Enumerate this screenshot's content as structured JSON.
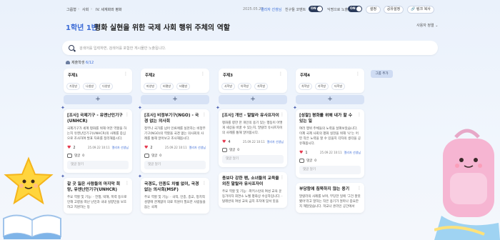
{
  "breadcrumb": [
    "그룹형",
    "사회",
    "IV. 세계화와 평화"
  ],
  "date": "2025.05.22",
  "teacher": "엘리자 선생님",
  "anon_label": "친구들 코멘트",
  "anon_toggle": "ON",
  "like_label": "익명으로 노출",
  "like_toggle": "ON",
  "buttons": {
    "settings": "설정",
    "share": "공유설정",
    "copy_link": "링크 복사"
  },
  "grade": "1학년 1반",
  "title": "평화 실현을 위한 국제 사회 행위 주체의 역할",
  "sort_label": "사용자 정렬",
  "search_placeholder": "검색어를 입력하면, 검색어를 포함한 게시물만 노출됩니다.",
  "students_label": "제출학생",
  "students_count": "6/12",
  "add_group": "그룹 추가",
  "add_symbol": "+",
  "comment_label": "댓글",
  "comment_placeholder": "댓글 달기",
  "columns": [
    {
      "title": "주제1",
      "tags": [
        "가정방",
        "나침방",
        "다양방"
      ],
      "cards": [
        {
          "title": "[조사] 국제기구 - 유엔난민기구(UNHCR)",
          "body": "국제기구가 세계 평화를 위해 어떤 역할을 하는지 유엔난민기구(UNHCR)의 사례를 중심으로 조사하여 발표 자료를 정리해봅시다.",
          "likes": "2",
          "date": "25.09.22 10:11",
          "author": "엘리자 선생님",
          "comments": "0"
        },
        {
          "title": "갈 곳 잃은 사람들의 마지막 희망, 유엔난민기구(UNHCR)",
          "body": "주요 역할 및 기능: · 전쟁, 박해, 폭력 등으로 인해 고향을 떠난 난민과 국내 실향민을 보호하고 지원하는 등"
        }
      ]
    },
    {
      "title": "주제2",
      "tags": [
        "마양방",
        "비평방",
        "비평방"
      ],
      "cards": [
        {
          "title": "[조사] 비정부기구(NGO) - 국경 없는 의사회",
          "body": "정부나 국가를 넘어 인류애를 실천하는 비정부기구(NGO)의 역할을 국경 없는 의사회의 사례를 통해 알아보고 조사해봅시다.",
          "likes": "2",
          "date": "25.09.22 10:11",
          "author": "엘리자 선생님",
          "comments": "0"
        },
        {
          "title": "국경도, 인종도 차별 없이, 국경 없는 의사회(MSF)",
          "body": "주요 역할 및 기능: · 국적, 인종, 종교, 정치적 성향에 관계없이 의료 지원이 필요한 사람들을 돕는 국제"
        }
      ]
    },
    {
      "title": "주제3",
      "tags": [
        "사학방",
        "아학방",
        "자학방"
      ],
      "cards": [
        {
          "title": "[조사] 개인 - 말랄라 유사프자이",
          "body": "평화를 향한 한 개인의 용기 있는 행동이 어떻게 세상을 바꿀 수 있는지, 말랄라 유사프자이의 사례를 통해 알아봅시다.",
          "likes": "4",
          "date": "25.09.22 10:11",
          "author": "엘리자 선생님",
          "comments": "0"
        },
        {
          "title": "총보다 강한 펜, 소녀들의 교육을 외친 말랄라 유사프자이",
          "body": "주요 역할 및 기능: ·파키스탄의 여성 교육 운동가이자 최연소 노벨 평화상 수상자입니다. ·탈레반의 여성 교육 금지 조치에 맞서 뜻을"
        }
      ]
    },
    {
      "title": "주제4",
      "tags": [
        "차학방",
        "카학방",
        "타학방"
      ],
      "cards": [
        {
          "title": "[성찰] 평화를 위해 내가 할 수 있는 일",
          "body": "여러 행위 주체들의 노력을 살펴보았습니다. 이제 국제 사회의 평화 실현을 위해 '나'는 어떤 작은 노력을 할 수 있을지 각자의 생각을 공유해봅시다.",
          "likes": "1",
          "date": "25.09.22 10:11",
          "author": "엘리자 선생님",
          "comments": "0"
        },
        {
          "title": "부당함에 침묵하지 않는 용기",
          "body": "말랄라의 사례를 보며, 부당한 일에 '그건 잘못됐어'라고 말하는 작은 용기가 얼마나 중요한지 깨달았습니다. 학교나 온라인 공간에서"
        }
      ]
    }
  ]
}
